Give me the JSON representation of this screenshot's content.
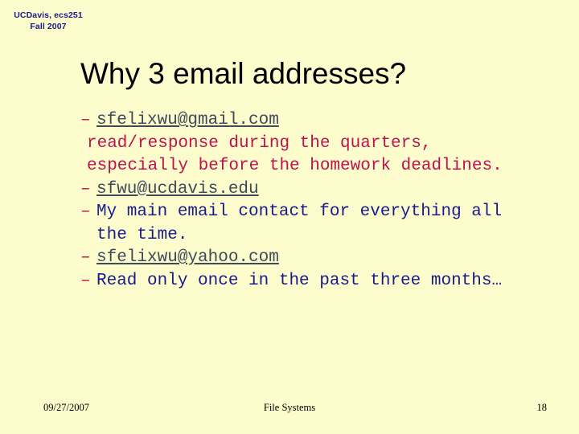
{
  "page": {
    "background_color": "#fcfccc"
  },
  "header": {
    "line1": "UCDavis, ecs251",
    "line2": "Fall 2007",
    "color": "#1a1a8c"
  },
  "title": {
    "text": "Why 3 email addresses?",
    "color": "#000000"
  },
  "colors": {
    "crimson": "#be1250",
    "navy": "#1a1a8c",
    "link": "#3f4a5a"
  },
  "body": {
    "dash_marker": "–",
    "items": [
      {
        "kind": "link",
        "text": "sfelixwu@gmail.com"
      },
      {
        "kind": "continuation",
        "text": "read/response during the quarters, especially before the homework deadlines."
      },
      {
        "kind": "link",
        "text": "sfwu@ucdavis.edu"
      },
      {
        "kind": "navy",
        "text": "My main email contact for everything all the time."
      },
      {
        "kind": "link",
        "text": "sfelixwu@yahoo.com"
      },
      {
        "kind": "navy",
        "text": "Read only once in the past three months…"
      }
    ]
  },
  "footer": {
    "date": "09/27/2007",
    "center": "File Systems",
    "page_number": "18"
  }
}
